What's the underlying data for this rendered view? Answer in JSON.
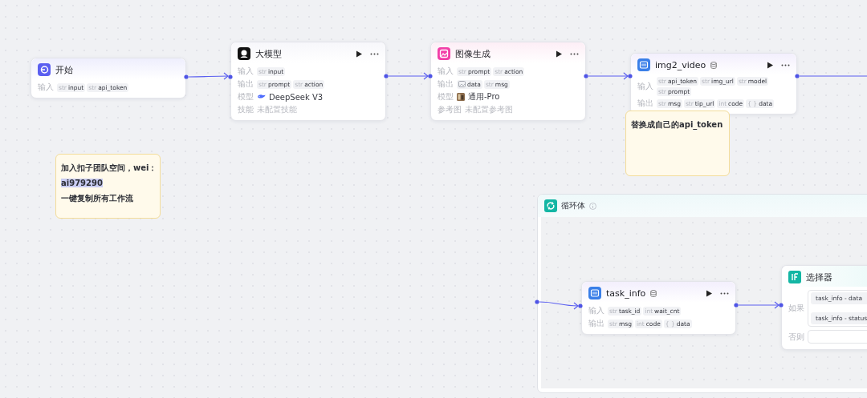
{
  "nodes": [
    {
      "kind": "start",
      "title": "开始",
      "run": false,
      "rows": [
        {
          "label": "输入",
          "kind": "params",
          "params": [
            {
              "type": "str",
              "name": "input"
            },
            {
              "type": "str",
              "name": "api_token"
            }
          ]
        }
      ]
    },
    {
      "kind": "llm",
      "title": "大模型",
      "run": true,
      "rows": [
        {
          "label": "输入",
          "kind": "params",
          "params": [
            {
              "type": "str",
              "name": "input"
            }
          ]
        },
        {
          "label": "输出",
          "kind": "params",
          "params": [
            {
              "type": "str",
              "name": "prompt"
            },
            {
              "type": "str",
              "name": "action"
            }
          ]
        },
        {
          "label": "模型",
          "kind": "llm_model",
          "value": "DeepSeek V3"
        },
        {
          "label": "技能",
          "kind": "empty",
          "value": "未配置技能"
        }
      ]
    },
    {
      "kind": "image",
      "title": "图像生成",
      "run": true,
      "rows": [
        {
          "label": "输入",
          "kind": "params",
          "params": [
            {
              "type": "str",
              "name": "prompt"
            },
            {
              "type": "str",
              "name": "action"
            }
          ]
        },
        {
          "label": "输出",
          "kind": "params",
          "params": [
            {
              "kind": "image",
              "name": "data"
            },
            {
              "type": "str",
              "name": "msg"
            }
          ]
        },
        {
          "label": "模型",
          "kind": "image_model",
          "value": "通用-Pro"
        },
        {
          "label": "参考图",
          "kind": "empty",
          "value": "未配置参考图"
        }
      ]
    },
    {
      "kind": "plugin",
      "title": "img2_video",
      "run": true,
      "rows": [
        {
          "label": "输入",
          "kind": "params",
          "params": [
            {
              "type": "str",
              "name": "api_token"
            },
            {
              "type": "str",
              "name": "img_url"
            },
            {
              "type": "str",
              "name": "model"
            },
            {
              "type": "str",
              "name": "prompt"
            }
          ]
        },
        {
          "label": "输出",
          "kind": "params",
          "params": [
            {
              "type": "str",
              "name": "msg"
            },
            {
              "type": "str",
              "name": "tip_url"
            },
            {
              "type": "int",
              "name": "code"
            },
            {
              "type": "{ }",
              "name": "data"
            }
          ]
        }
      ]
    }
  ],
  "notes": [
    {
      "lines": [
        {
          "text": "加入扣子团队空间，wei：",
          "highlighted": false
        },
        {
          "text": "ai979290",
          "highlighted": true
        },
        {
          "text": "一键复制所有工作流",
          "highlighted": false
        }
      ]
    },
    {
      "lines": [
        {
          "text": "替换成自己的api_token",
          "highlighted": false
        }
      ]
    }
  ],
  "loop": {
    "title": "循环体",
    "nodes": [
      {
        "kind": "plugin",
        "title": "task_info",
        "run": true,
        "rows": [
          {
            "label": "输入",
            "kind": "params",
            "params": [
              {
                "type": "str",
                "name": "task_id"
              },
              {
                "type": "int",
                "name": "wait_cnt"
              }
            ]
          },
          {
            "label": "输出",
            "kind": "params",
            "params": [
              {
                "type": "str",
                "name": "msg"
              },
              {
                "type": "int",
                "name": "code"
              },
              {
                "type": "{ }",
                "name": "data"
              }
            ]
          }
        ]
      },
      {
        "kind": "condition",
        "title": "选择器",
        "run": false,
        "rows": [
          {
            "label": "如果",
            "kind": "conditions",
            "items": [
              "task_info - data",
              "task_info - status"
            ]
          },
          {
            "label": "否则",
            "kind": "else"
          }
        ]
      }
    ]
  }
}
